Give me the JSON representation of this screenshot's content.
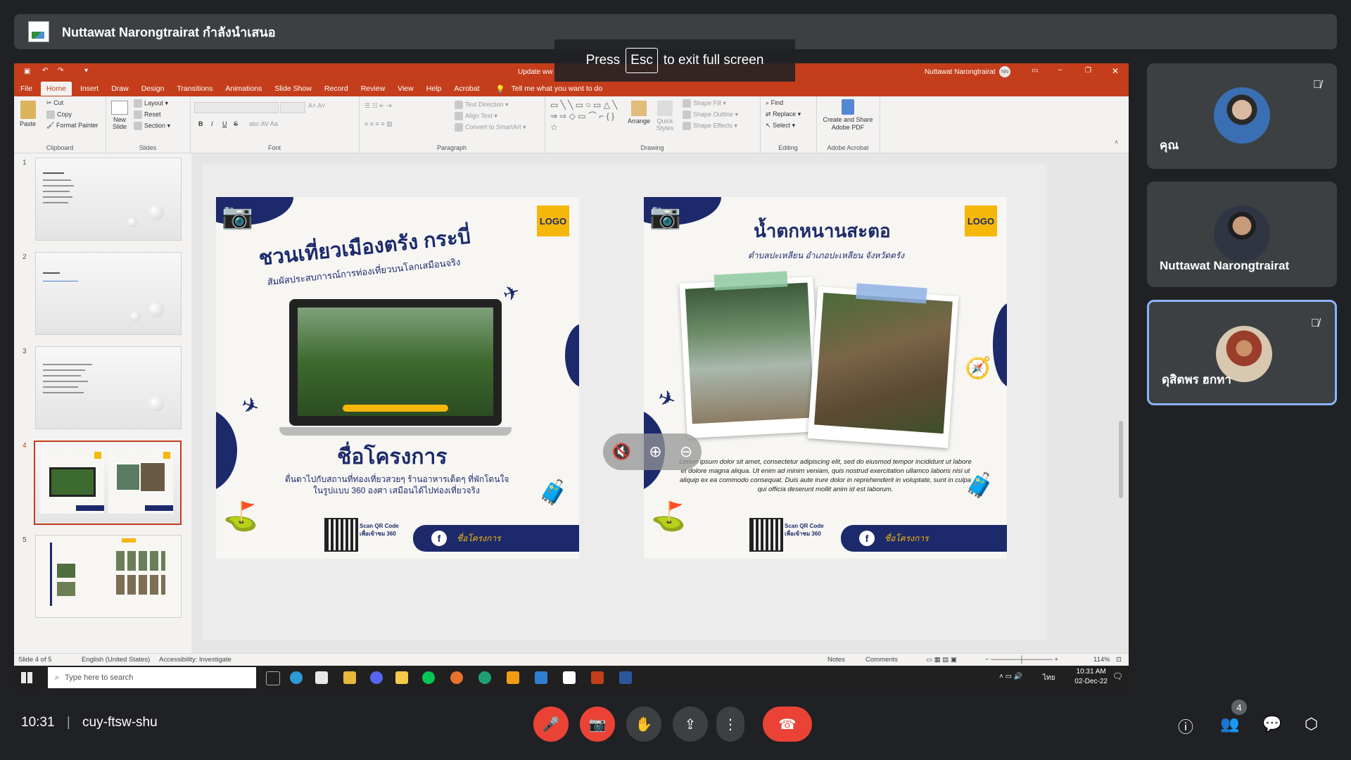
{
  "presenter_banner": {
    "text": "Nuttawat Narongtrairat กำลังนำเสนอ"
  },
  "fullscreen_toast": {
    "press": "Press",
    "key": "Esc",
    "rest": "to exit full screen"
  },
  "ppt": {
    "title": "Update ww",
    "user": "Nuttawat Narongtrairat",
    "user_initials": "NN",
    "tabs": [
      "File",
      "Home",
      "Insert",
      "Draw",
      "Design",
      "Transitions",
      "Animations",
      "Slide Show",
      "Record",
      "Review",
      "View",
      "Help",
      "Acrobat"
    ],
    "tell_me": "Tell me what you want to do",
    "ribbon": {
      "clipboard": {
        "paste": "Paste",
        "cut": "Cut",
        "copy": "Copy",
        "format_painter": "Format Painter",
        "label": "Clipboard"
      },
      "slides": {
        "new_slide": "New Slide",
        "layout": "Layout",
        "reset": "Reset",
        "section": "Section",
        "label": "Slides"
      },
      "font": {
        "label": "Font",
        "bold": "B",
        "italic": "I",
        "underline": "U",
        "strike": "S"
      },
      "paragraph": {
        "label": "Paragraph",
        "text_direction": "Text Direction",
        "align_text": "Align Text",
        "smartart": "Convert to SmartArt"
      },
      "drawing": {
        "label": "Drawing",
        "arrange": "Arrange",
        "quick_styles": "Quick Styles",
        "shape_fill": "Shape Fill",
        "shape_outline": "Shape Outline",
        "shape_effects": "Shape Effects"
      },
      "editing": {
        "label": "Editing",
        "find": "Find",
        "replace": "Replace",
        "select": "Select"
      },
      "acrobat": {
        "label": "Adobe Acrobat",
        "create": "Create and Share Adobe PDF"
      }
    },
    "thumbnails": [
      "1",
      "2",
      "3",
      "4",
      "5"
    ],
    "slide": {
      "left": {
        "logo": "LOGO",
        "title": "ชวนเที่ยวเมืองตรัง กระบี่",
        "subtitle": "สัมผัสประสบการณ์การท่องเที่ยวบนโลกเสมือนจริง",
        "project": "ชื่อโครงการ",
        "desc1": "ตื่นตาไปกับสถานที่ท่องเที่ยวสวยๆ ร้านอาหารเด็ดๆ ที่พักโดนใจ",
        "desc2": "ในรูปแบบ 360 องศา เสมือนได้ไปท่องเที่ยวจริง",
        "qr_text": "Scan QR Code เพื่อเข้าชม 360",
        "fb": "ชื่อโครงการ"
      },
      "right": {
        "logo": "LOGO",
        "title": "น้ำตกหนานสะตอ",
        "subtitle": "ตำบลปะเหลียน อำเภอปะเหลียน จังหวัดตรัง",
        "lorem": "Lorem ipsum dolor sit amet, consectetur adipiscing elit, sed do eiusmod tempor incididunt ut labore et dolore magna aliqua. Ut enim ad minim veniam, quis nostrud exercitation ullamco laboris nisi ut aliquip ex ea commodo consequat. Duis aute irure dolor in reprehenderit in voluptate, sunt in culpa qui officia deserunt mollit anim id est laborum.",
        "qr_text": "Scan QR Code เพื่อเข้าชม 360",
        "fb": "ชื่อโครงการ"
      }
    },
    "status": {
      "slide_of": "Slide 4 of 5",
      "language": "English (United States)",
      "accessibility": "Accessibility: Investigate",
      "notes": "Notes",
      "comments": "Comments",
      "zoom": "114%"
    },
    "taskbar": {
      "search_placeholder": "Type here to search",
      "time": "10:31 AM",
      "date": "02-Dec-22",
      "lang": "ไทย"
    }
  },
  "participants": [
    {
      "name": "คุณ",
      "muted": true
    },
    {
      "name": "Nuttawat Narongtrairat",
      "muted": false
    },
    {
      "name": "ดุสิตพร ฮกทา",
      "muted": true,
      "active": true
    }
  ],
  "meeting": {
    "time": "10:31",
    "separator": "|",
    "code": "cuy-ftsw-shu",
    "participant_count": "4"
  },
  "colors": {
    "ppt_accent": "#c43e1c",
    "end_call": "#ea4335",
    "poster_navy": "#1c2a6b",
    "poster_yellow": "#f5b70a",
    "active_tile": "#8ab4f8"
  }
}
